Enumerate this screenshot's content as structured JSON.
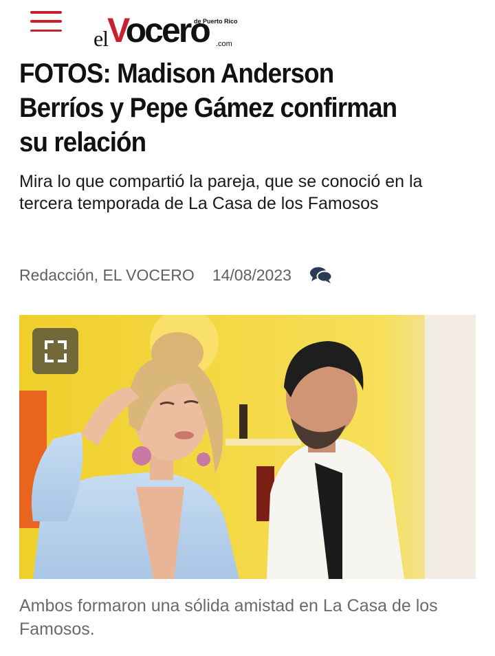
{
  "header": {
    "menu_icon": "hamburger-menu-icon",
    "logo": {
      "prefix": "el",
      "brand": "Vocero",
      "brand_first": "V",
      "brand_rest": "ocero",
      "tagline": "de Puerto Rico",
      "suffix": ".com",
      "brand_color": "#c8202f"
    }
  },
  "article": {
    "headline": "FOTOS: Madison Anderson Berríos y Pepe Gámez confirman su relación",
    "subheadline": "Mira lo que compartió la pareja, que se conoció en la tercera temporada de La Casa de los Famosos",
    "author": "Redacción, EL VOCERO",
    "date": "14/08/2023",
    "comment_icon": "comments-icon",
    "photo": {
      "expand_icon": "fullscreen-expand-icon",
      "caption": "Ambos formaron una sólida amistad en La Casa de los Famosos."
    }
  }
}
